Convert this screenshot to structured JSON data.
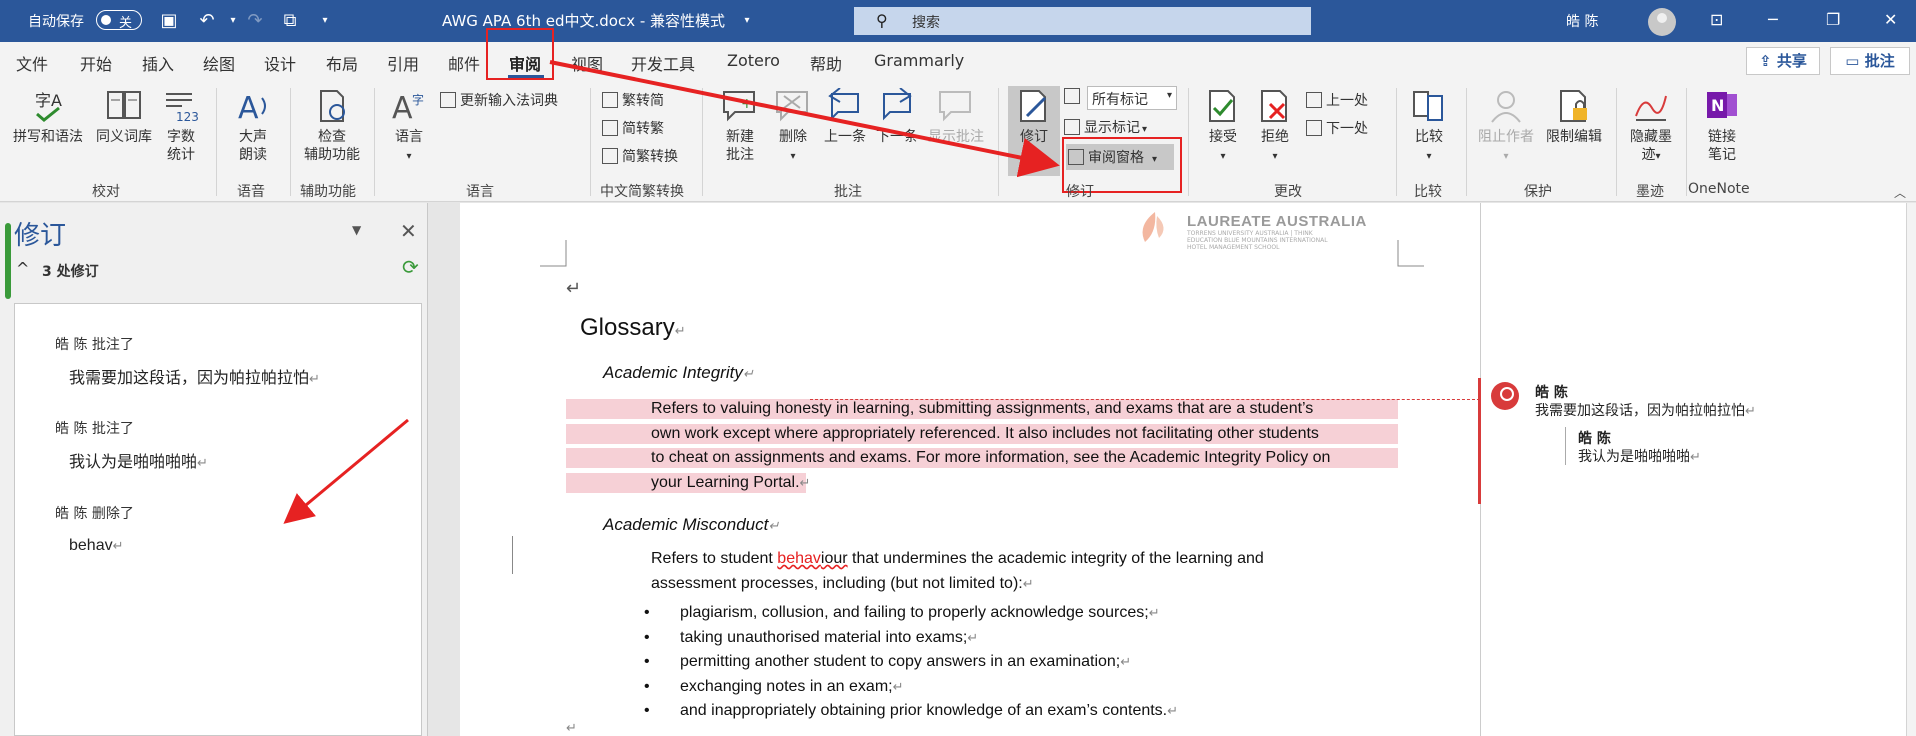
{
  "titlebar": {
    "autosave_label": "自动保存",
    "autosave_state": "关",
    "doc_title": "AWG APA 6th ed中文.docx  -  兼容性模式",
    "search_placeholder": "搜索",
    "user_name": "皓 陈"
  },
  "menu": {
    "tabs": [
      "文件",
      "开始",
      "插入",
      "绘图",
      "设计",
      "布局",
      "引用",
      "邮件",
      "审阅",
      "视图",
      "开发工具",
      "Zotero",
      "帮助",
      "Grammarly"
    ],
    "active_tab": "审阅",
    "share_label": "共享",
    "comment_label": "批注"
  },
  "ribbon": {
    "spelling": "拼写和语法",
    "thesaurus": "同义词库",
    "wordcount_1": "字数",
    "wordcount_2": "统计",
    "readaloud_1": "大声",
    "readaloud_2": "朗读",
    "accessibility_1": "检查",
    "accessibility_2": "辅助功能",
    "language": "语言",
    "update_ime": "更新输入法词典",
    "trad_to_simp": "繁转简",
    "simp_to_trad": "简转繁",
    "conversion": "简繁转换",
    "new_comment_1": "新建",
    "new_comment_2": "批注",
    "delete": "删除",
    "previous": "上一条",
    "next": "下一条",
    "show_comments": "显示批注",
    "track_changes": "修订",
    "all_markup": "所有标记",
    "show_markup": "显示标记",
    "review_pane": "审阅窗格",
    "accept": "接受",
    "reject": "拒绝",
    "prev_change": "上一处",
    "next_change": "下一处",
    "compare": "比较",
    "block_authors": "阻止作者",
    "restrict": "限制编辑",
    "hide_ink_1": "隐藏墨",
    "hide_ink_2": "迹",
    "linked_notes_1": "链接",
    "linked_notes_2": "笔记",
    "groups": {
      "proofing": "校对",
      "speech": "语音",
      "accessibility": "辅助功能",
      "language": "语言",
      "chinese": "中文简繁转换",
      "comments": "批注",
      "tracking": "修订",
      "changes": "更改",
      "compare": "比较",
      "protect": "保护",
      "ink": "墨迹",
      "onenote": "OneNote"
    }
  },
  "revision_pane": {
    "title": "修订",
    "count": "3 处修订",
    "items": [
      {
        "author_action": "皓 陈 批注了",
        "content": "我需要加这段话，因为帕拉帕拉怕"
      },
      {
        "author_action": "皓 陈 批注了",
        "content": "我认为是啪啪啪啪"
      },
      {
        "author_action": "皓 陈 删除了",
        "content": "behav"
      }
    ]
  },
  "document": {
    "logo": "LAUREATE AUSTRALIA",
    "logo_sub": "TORRENS UNIVERSITY AUSTRALIA | THINK EDUCATION BLUE MOUNTAINS INTERNATIONAL HOTEL MANAGEMENT SCHOOL",
    "heading": "Glossary",
    "term1": "Academic Integrity",
    "para1_lines": [
      "Refers to valuing honesty in learning, submitting assignments, and exams that are a student’s",
      "own work except where appropriately referenced. It also includes not facilitating other students",
      "to cheat on assignments and exams. For more information, see the Academic Integrity Policy on",
      "your Learning Portal."
    ],
    "term2": "Academic Misconduct",
    "para2_a": "Refers to student ",
    "para2_deleted": "behav",
    "para2_b": "iour",
    "para2_c": " that undermines the academic integrity of the learning and",
    "para2_line2": "assessment processes, including (but not limited to):",
    "bullets": [
      "plagiarism, collusion, and failing to properly acknowledge sources;",
      "taking unauthorised material into exams;",
      "permitting another student to copy answers in an examination;",
      "exchanging notes in an exam;",
      "and inappropriately obtaining prior knowledge of an exam’s contents."
    ]
  },
  "comments": [
    {
      "name": "皓 陈",
      "text": "我需要加这段话，因为帕拉帕拉怕"
    },
    {
      "name": "皓 陈",
      "text": "我认为是啪啪啪啪"
    }
  ],
  "colors": {
    "title_bar": "#2b579a",
    "highlight": "#e62222",
    "insert_bg": "#f6d0d6"
  }
}
